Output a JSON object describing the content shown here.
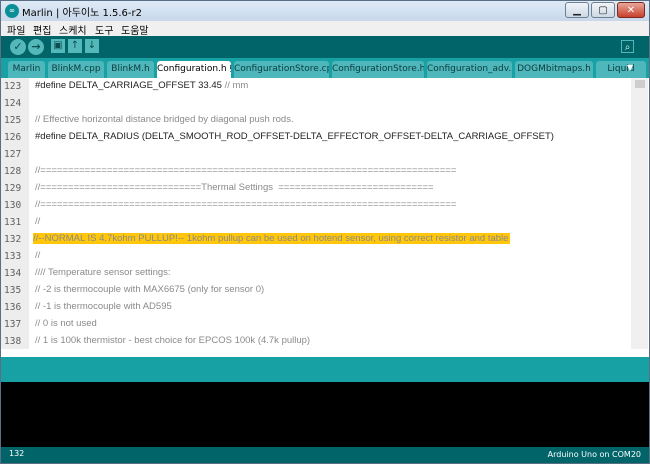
{
  "window": {
    "title": "Marlin | 아두이노 1.5.6-r2",
    "app_icon": "arduino-logo-icon",
    "buttons": {
      "minimize": "▁",
      "maximize": "▢",
      "close": "✕"
    }
  },
  "menu": [
    "파일",
    "편집",
    "스케치",
    "도구",
    "도움말"
  ],
  "toolbar": {
    "verify": "✓",
    "upload": "→",
    "new": "▣",
    "open": "↑",
    "save": "↓",
    "serial_monitor": "⌕"
  },
  "tabs": [
    {
      "label": "Marlin",
      "active": false
    },
    {
      "label": "BlinkM.cpp",
      "active": false
    },
    {
      "label": "BlinkM.h",
      "active": false
    },
    {
      "label": "Configuration.h §",
      "active": true
    },
    {
      "label": "ConfigurationStore.cpp",
      "active": false
    },
    {
      "label": "ConfigurationStore.h",
      "active": false
    },
    {
      "label": "Configuration_adv.h",
      "active": false
    },
    {
      "label": "DOGMbitmaps.h",
      "active": false
    },
    {
      "label": "Liquid",
      "active": false
    }
  ],
  "tab_dropdown": "▼",
  "editor": {
    "lines": [
      {
        "num": "123",
        "code": "#define DELTA_CARRIAGE_OFFSET 33.45 ",
        "comment": "// mm"
      },
      {
        "num": "124",
        "code": "",
        "comment": ""
      },
      {
        "num": "125",
        "code": "",
        "comment": "// Effective horizontal distance bridged by diagonal push rods."
      },
      {
        "num": "126",
        "code": "#define DELTA_RADIUS (DELTA_SMOOTH_ROD_OFFSET-DELTA_EFFECTOR_OFFSET-DELTA_CARRIAGE_OFFSET)",
        "comment": ""
      },
      {
        "num": "127",
        "code": "",
        "comment": ""
      },
      {
        "num": "128",
        "code": "",
        "comment": "//==========================================================================="
      },
      {
        "num": "129",
        "code": "",
        "comment": "//=============================Thermal Settings  ============================"
      },
      {
        "num": "130",
        "code": "",
        "comment": "//==========================================================================="
      },
      {
        "num": "131",
        "code": "",
        "comment": "//"
      },
      {
        "num": "132",
        "code": "",
        "comment": "//--NORMAL IS 4.7kohm PULLUP!-- 1kohm pullup can be used on hotend sensor, using correct resistor and table"
      },
      {
        "num": "133",
        "code": "",
        "comment": "//"
      },
      {
        "num": "134",
        "code": "",
        "comment": "//// Temperature sensor settings:"
      },
      {
        "num": "135",
        "code": "",
        "comment": "// -2 is thermocouple with MAX6675 (only for sensor 0)"
      },
      {
        "num": "136",
        "code": "",
        "comment": "// -1 is thermocouple with AD595"
      },
      {
        "num": "137",
        "code": "",
        "comment": "// 0 is not used"
      },
      {
        "num": "138",
        "code": "",
        "comment": "// 1 is 100k thermistor - best choice for EPCOS 100k (4.7k pullup)"
      }
    ],
    "highlighted_line": "132"
  },
  "footer": {
    "line_number": "132",
    "board": "Arduino Uno on COM20"
  },
  "colors": {
    "toolbar": "#006468",
    "tabbar": "#17a1a5",
    "highlight": "#ffc60a"
  }
}
